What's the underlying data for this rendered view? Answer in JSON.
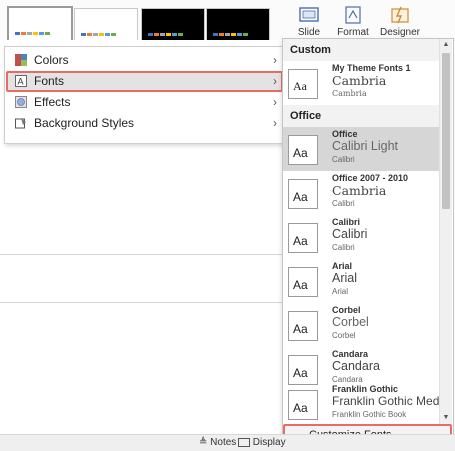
{
  "ribbon": {
    "buttons": [
      {
        "label": "Slide",
        "icon": "slide-size-icon"
      },
      {
        "label": "Format",
        "icon": "format-background-icon"
      },
      {
        "label": "Designer",
        "icon": "designer-icon"
      }
    ]
  },
  "thumbnails": [
    {
      "bg": "#ffffff",
      "selected": true
    },
    {
      "bg": "#ffffff",
      "selected": false
    },
    {
      "bg": "#000000",
      "selected": false
    },
    {
      "bg": "#000000",
      "selected": false
    }
  ],
  "menu": {
    "items": [
      {
        "label": "Colors",
        "icon": "colors-icon",
        "selected": false
      },
      {
        "label": "Fonts",
        "icon": "fonts-icon",
        "selected": true
      },
      {
        "label": "Effects",
        "icon": "effects-icon",
        "selected": false
      },
      {
        "label": "Background Styles",
        "icon": "background-styles-icon",
        "selected": false
      }
    ],
    "chevron": "›"
  },
  "font_panel": {
    "custom_header": "Custom",
    "office_header": "Office",
    "aa_label": "Aa",
    "custom_fonts": [
      {
        "name": "My Theme Fonts 1",
        "heading": "Cambria",
        "body": "Cambria"
      }
    ],
    "office_fonts": [
      {
        "name": "Office",
        "heading": "Calibri Light",
        "body": "Calibri",
        "selected": true
      },
      {
        "name": "Office 2007 - 2010",
        "heading": "Cambria",
        "body": "Calibri"
      },
      {
        "name": "Calibri",
        "heading": "Calibri",
        "body": "Calibri"
      },
      {
        "name": "Arial",
        "heading": "Arial",
        "body": "Arial"
      },
      {
        "name": "Corbel",
        "heading": "Corbel",
        "body": "Corbel"
      },
      {
        "name": "Candara",
        "heading": "Candara",
        "body": "Candara"
      },
      {
        "name": "Franklin Gothic",
        "heading": "Franklin Gothic Med",
        "body": "Franklin Gothic Book"
      }
    ],
    "customize_label": "Customize Fonts..."
  },
  "statusbar": {
    "notes": "Notes",
    "display": "Display"
  },
  "colors": {
    "accent_highlight": "#e96c62"
  }
}
